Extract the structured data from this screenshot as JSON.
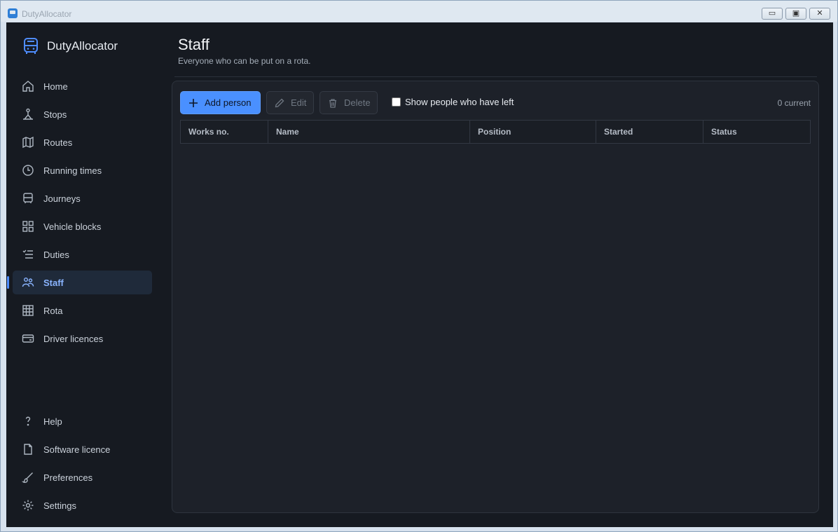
{
  "window": {
    "title": "DutyAllocator",
    "controls": {
      "minimize": "▭",
      "maximize": "▣",
      "close": "✕"
    }
  },
  "sidebar": {
    "brand": "DutyAllocator",
    "items": [
      {
        "label": "Home",
        "icon": "home-icon"
      },
      {
        "label": "Stops",
        "icon": "stop-sign-icon"
      },
      {
        "label": "Routes",
        "icon": "map-icon"
      },
      {
        "label": "Running times",
        "icon": "clock-icon"
      },
      {
        "label": "Journeys",
        "icon": "bus-icon"
      },
      {
        "label": "Vehicle blocks",
        "icon": "grid-icon"
      },
      {
        "label": "Duties",
        "icon": "checklist-icon"
      },
      {
        "label": "Staff",
        "icon": "people-icon",
        "active": true
      },
      {
        "label": "Rota",
        "icon": "table-icon"
      },
      {
        "label": "Driver licences",
        "icon": "card-icon"
      }
    ],
    "footer_items": [
      {
        "label": "Help",
        "icon": "question-icon"
      },
      {
        "label": "Software licence",
        "icon": "document-icon"
      },
      {
        "label": "Preferences",
        "icon": "brush-icon"
      },
      {
        "label": "Settings",
        "icon": "gear-icon"
      }
    ]
  },
  "main": {
    "title": "Staff",
    "subtitle": "Everyone who can be put on a rota.",
    "toolbar": {
      "add_label": "Add person",
      "edit_label": "Edit",
      "delete_label": "Delete",
      "show_left_label": "Show people who have left",
      "show_left_checked": false,
      "count_label": "0 current"
    },
    "table": {
      "columns": [
        "Works no.",
        "Name",
        "Position",
        "Started",
        "Status"
      ],
      "rows": []
    }
  },
  "colors": {
    "accent": "#4a90ff",
    "background": "#161a21",
    "panel": "#1d2129",
    "active_nav_text": "#8ab4ff"
  }
}
